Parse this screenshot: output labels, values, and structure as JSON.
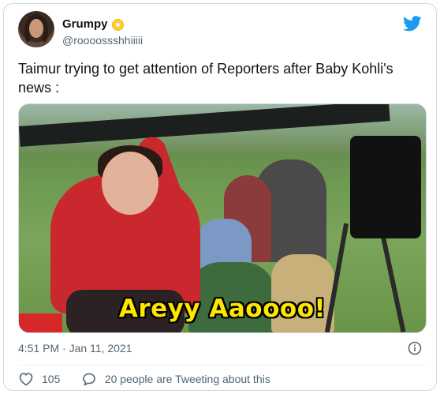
{
  "author": {
    "display_name": "Grumpy",
    "handle": "@roooossshhiiiii",
    "avatar_icon": "profile-avatar",
    "badge_icon": "sunflower-emoji"
  },
  "brand": {
    "icon": "twitter-bird-icon",
    "color": "#1d9bf0"
  },
  "tweet": {
    "text": "Taimur trying to get attention of Reporters after Baby Kohli's news :",
    "media_caption": "Areyy Aaoooo!",
    "timestamp": "4:51 PM · Jan 11, 2021"
  },
  "actions": {
    "like_count": "105",
    "reply_text": "20 people are Tweeting about this"
  },
  "colors": {
    "text_primary": "#0f1419",
    "text_secondary": "#536471",
    "border": "#cfd9de",
    "caption": "#ffe600"
  }
}
